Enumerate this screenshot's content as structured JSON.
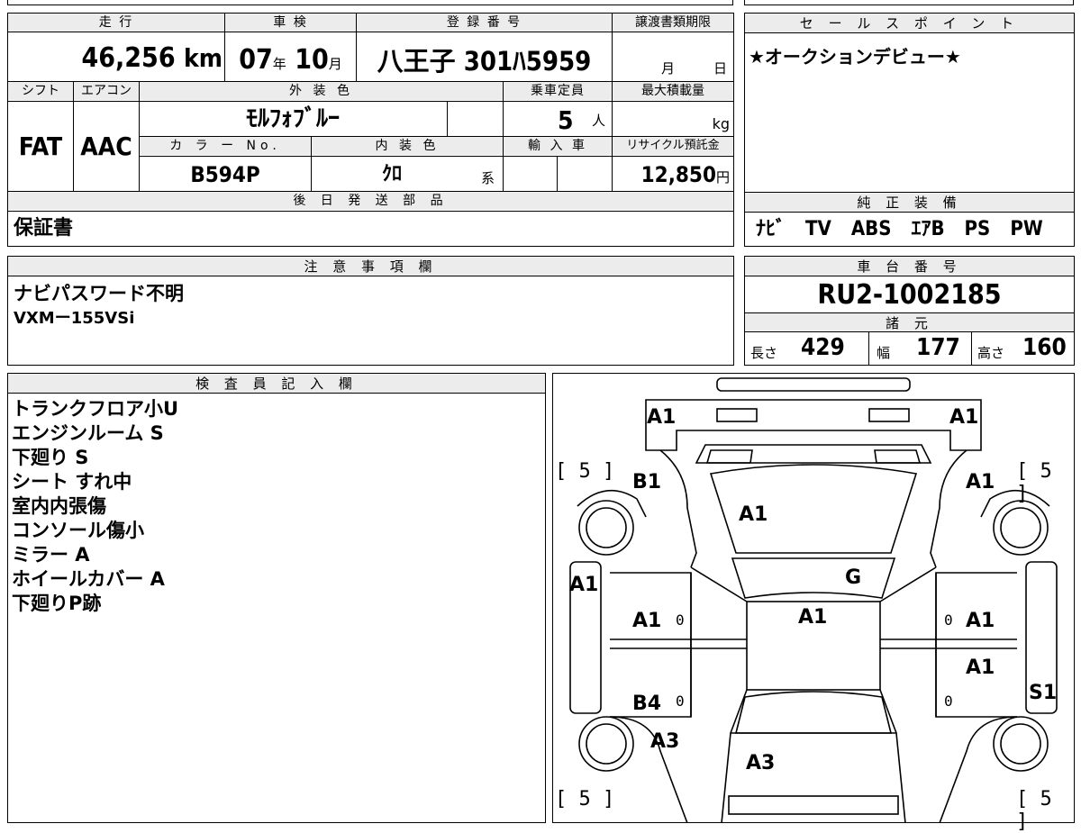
{
  "sheet": {
    "mileage_label": "走 行",
    "mileage_value": "46,256",
    "mileage_unit": "km",
    "inspection_label": "車 検",
    "inspection_year": "07",
    "inspection_year_unit": "年",
    "inspection_month": "10",
    "inspection_month_unit": "月",
    "registration_label": "登 録 番 号",
    "registration_value": "八王子 301ﾊ5959",
    "transfer_label": "譲渡書類期限",
    "transfer_month_unit": "月",
    "transfer_day_unit": "日",
    "shift_label": "シフト",
    "shift_value": "FAT",
    "aircon_label": "エアコン",
    "aircon_value": "AAC",
    "exterior_label": "外 装 色",
    "exterior_value": "ﾓﾙﾌｫﾌﾞﾙｰ",
    "capacity_label": "乗車定員",
    "capacity_value": "5",
    "capacity_unit": "人",
    "maxload_label": "最大積載量",
    "maxload_unit": "kg",
    "colorno_label": "カ ラ ー No.",
    "colorno_value": "B594P",
    "interior_label": "内 装 色",
    "interior_value": "ｸﾛ",
    "interior_unit": "系",
    "import_label": "輸 入 車",
    "recycle_label": "リサイクル預託金",
    "recycle_value": "12,850",
    "recycle_unit": "円",
    "shipping_label": "後 日 発 送 部 品",
    "shipping_value": "保証書",
    "sales_label": "セ ー ル ス ポ イ ン ト",
    "sales_value": "★オークションデビュー★",
    "equipment_label": "純 正 装 備",
    "equipment_value": "ﾅﾋﾞ　TV　ABS　ｴｱB　PS　PW",
    "caution_label": "注 意 事 項 欄",
    "caution_lines": [
      "ナビパスワード不明",
      "VXMー155VSi"
    ],
    "chassis_label": "車 台 番 号",
    "chassis_value": "RU2-1002185",
    "spec_label": "諸 元",
    "length_label": "長さ",
    "length_value": "429",
    "width_label": "幅",
    "width_value": "177",
    "height_label": "高さ",
    "height_value": "160",
    "inspector_label": "検 査 員 記 入 欄",
    "inspector_lines": [
      "トランクフロア小U",
      "エンジンルーム S",
      "下廻り S",
      "シート すれ中",
      "室内内張傷",
      "コンソール傷小",
      "ミラー A",
      "ホイールカバー A",
      "下廻りP跡"
    ]
  },
  "diagram": {
    "marks": {
      "front_left": "A1",
      "front_right": "A1",
      "fender_left": "B1",
      "fender_right": "A1",
      "hood": "A1",
      "windshield": "G",
      "roof": "A1",
      "pillar_left": "A1",
      "door_front_left": "A1",
      "door_front_right": "A1",
      "door_rear_left": "B4",
      "door_rear_right": "A1",
      "step_right": "S1",
      "quarter_left": "A3",
      "rear": "A3"
    },
    "zeros": [
      "0",
      "0",
      "0",
      "0"
    ],
    "tires": [
      "[ 5 ]",
      "[ 5 ]",
      "[ 5 ]",
      "[ 5 ]"
    ]
  }
}
